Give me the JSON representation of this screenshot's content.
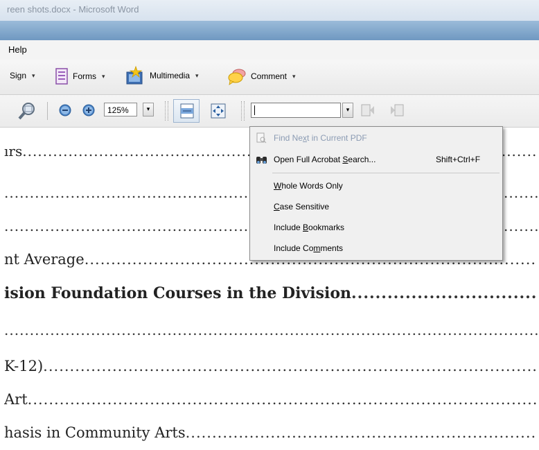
{
  "window": {
    "title": "reen shots.docx - Microsoft Word"
  },
  "menubar": {
    "items": [
      {
        "label": "Help"
      }
    ]
  },
  "toolbar1": {
    "sign_label": "Sign",
    "forms_label": "Forms",
    "multimedia_label": "Multimedia",
    "comment_label": "Comment",
    "dropdown_glyph": "▾"
  },
  "toolbar2": {
    "zoom_value": "125%",
    "dropdown_glyph": "▾",
    "search_value": ""
  },
  "search_menu": {
    "items": [
      {
        "pre": "Find Ne",
        "key": "x",
        "post": "t in Current PDF",
        "shortcut": "",
        "disabled": true,
        "icon": "find-next-icon"
      },
      {
        "pre": "Open Full Acrobat ",
        "key": "S",
        "post": "earch...",
        "shortcut": "Shift+Ctrl+F",
        "disabled": false,
        "icon": "binoculars-icon"
      },
      {
        "pre": "",
        "key": "W",
        "post": "hole Words Only",
        "shortcut": "",
        "disabled": false
      },
      {
        "pre": "",
        "key": "C",
        "post": "ase Sensitive",
        "shortcut": "",
        "disabled": false
      },
      {
        "pre": "Include ",
        "key": "B",
        "post": "ookmarks",
        "shortcut": "",
        "disabled": false
      },
      {
        "pre": "Include Co",
        "key": "m",
        "post": "ments",
        "shortcut": "",
        "disabled": false
      }
    ]
  },
  "document": {
    "lines": [
      {
        "text": "ırs",
        "bold": false
      },
      {
        "text": "",
        "bold": false
      },
      {
        "text": "",
        "bold": false
      },
      {
        "text": "nt Average",
        "bold": false
      },
      {
        "text": "ision Foundation Courses in the Division",
        "bold": true
      },
      {
        "text": "",
        "bold": false
      },
      {
        "text": "K-12)",
        "bold": false
      },
      {
        "text": " Art",
        "bold": false
      },
      {
        "text": "hasis in Community Arts",
        "bold": false
      }
    ]
  },
  "colors": {
    "disabled_text": "#8b9bb3",
    "title_band": "#7fa6cc",
    "forms_icon": "#b07cc6"
  }
}
